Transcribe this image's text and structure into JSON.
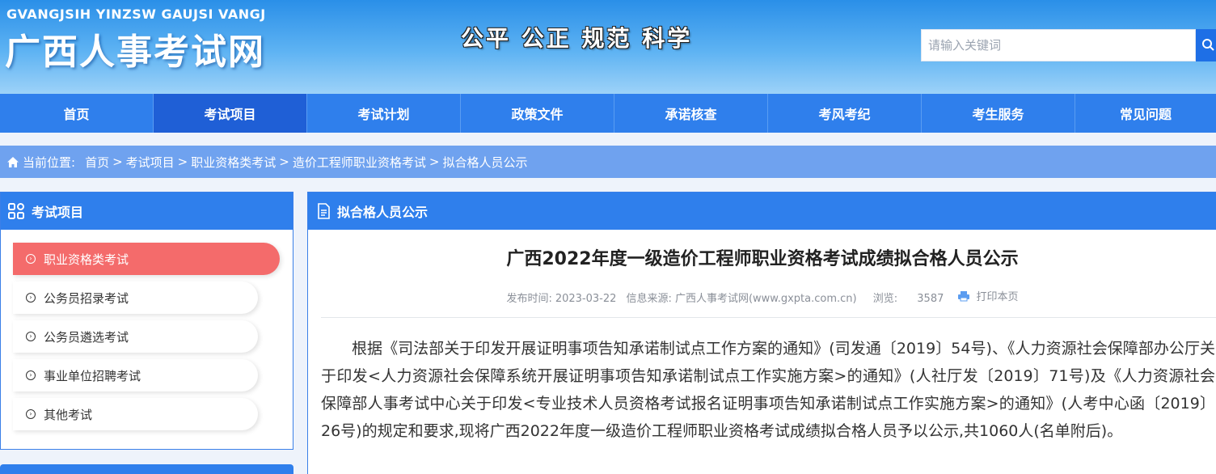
{
  "header": {
    "logo_en": "GVANGJSIH YINZSW GAUJSI VANGJ",
    "logo_cn": "广西人事考试网",
    "slogan": "公平  公正  规范  科学",
    "search_placeholder": "请输入关键词"
  },
  "nav": {
    "items": [
      "首页",
      "考试项目",
      "考试计划",
      "政策文件",
      "承诺核查",
      "考风考纪",
      "考生服务",
      "常见问题"
    ],
    "active": "考试项目"
  },
  "breadcrumb": {
    "label": "当前位置:",
    "items": [
      "首页",
      "考试项目",
      "职业资格类考试",
      "造价工程师职业资格考试",
      "拟合格人员公示"
    ],
    "separator": ">"
  },
  "sidebar": {
    "title": "考试项目",
    "items": [
      "职业资格类考试",
      "公务员招录考试",
      "公务员遴选考试",
      "事业单位招聘考试",
      "其他考试"
    ],
    "active_index": 0
  },
  "main": {
    "section_title": "拟合格人员公示",
    "article_title": "广西2022年度一级造价工程师职业资格考试成绩拟合格人员公示",
    "meta": {
      "publish_label": "发布时间:",
      "publish_date": "2023-03-22",
      "source_label": "信息来源:",
      "source": "广西人事考试网(www.gxpta.com.cn)",
      "views_label": "浏览:",
      "views": "3587",
      "print_label": "打印本页"
    },
    "body": "根据《司法部关于印发开展证明事项告知承诺制试点工作方案的通知》(司发通〔2019〕54号)、《人力资源社会保障部办公厅关于印发<人力资源社会保障系统开展证明事项告知承诺制试点工作实施方案>的通知》(人社厅发〔2019〕71号)及《人力资源社会保障部人事考试中心关于印发<专业技术人员资格考试报名证明事项告知承诺制试点工作实施方案>的通知》(人考中心函〔2019〕26号)的规定和要求,现将广西2022年度一级造价工程师职业资格考试成绩拟合格人员予以公示,共1060人(名单附后)。"
  },
  "colors": {
    "primary": "#2f7fec",
    "nav_active": "#1f5fd6",
    "breadcrumb_bg": "#6fa2ef",
    "sidebar_active": "#f46b6b"
  }
}
